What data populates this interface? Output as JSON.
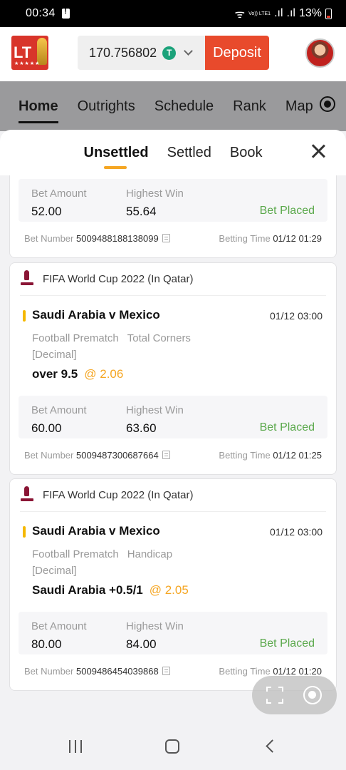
{
  "status_bar": {
    "time": "00:34",
    "network_label": "Vo)) LTE1",
    "battery": "13%"
  },
  "header": {
    "logo_text": "LT",
    "balance": "170.756802",
    "coin_symbol": "T",
    "deposit_label": "Deposit"
  },
  "nav": {
    "tabs": [
      "Home",
      "Outrights",
      "Schedule",
      "Rank",
      "Map"
    ],
    "active": "Home"
  },
  "sheet": {
    "tabs": [
      "Unsettled",
      "Settled",
      "Book"
    ],
    "active": "Unsettled"
  },
  "bets": [
    {
      "amount_label": "Bet Amount",
      "amount": "52.00",
      "win_label": "Highest Win",
      "win": "55.64",
      "status": "Bet Placed",
      "bet_number_label": "Bet Number",
      "bet_number": "5009488188138099",
      "time_label": "Betting Time",
      "time": "01/12 01:29"
    },
    {
      "league": "FIFA World Cup 2022 (In Qatar)",
      "match": "Saudi Arabia v Mexico",
      "match_time": "01/12 03:00",
      "market_type": "Football Prematch",
      "market": "Total Corners",
      "format": "[Decimal]",
      "selection": "over 9.5",
      "odds": "@ 2.06",
      "amount_label": "Bet Amount",
      "amount": "60.00",
      "win_label": "Highest Win",
      "win": "63.60",
      "status": "Bet Placed",
      "bet_number_label": "Bet Number",
      "bet_number": "5009487300687664",
      "time_label": "Betting Time",
      "time": "01/12 01:25"
    },
    {
      "league": "FIFA World Cup 2022 (In Qatar)",
      "match": "Saudi Arabia v Mexico",
      "match_time": "01/12 03:00",
      "market_type": "Football Prematch",
      "market": "Handicap",
      "format": "[Decimal]",
      "selection": "Saudi Arabia +0.5/1",
      "odds": "@ 2.05",
      "amount_label": "Bet Amount",
      "amount": "80.00",
      "win_label": "Highest Win",
      "win": "84.00",
      "status": "Bet Placed",
      "bet_number_label": "Bet Number",
      "bet_number": "5009486454039868",
      "time_label": "Betting Time",
      "time": "01/12 01:20"
    }
  ],
  "colors": {
    "accent": "#e84a2c",
    "odds": "#f5a623",
    "status_ok": "#5aa84b",
    "team_marker": "#f5b800"
  }
}
